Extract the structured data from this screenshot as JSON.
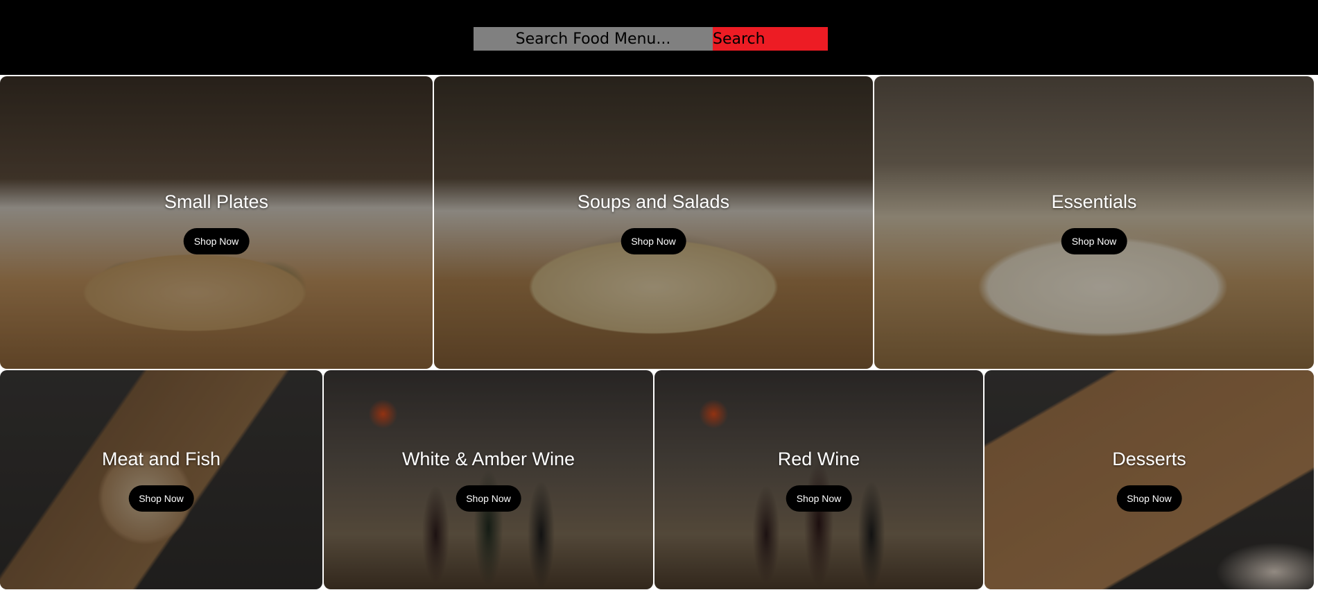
{
  "search": {
    "placeholder": "Search Food Menu...",
    "button_label": "Search"
  },
  "colors": {
    "header_bg": "#000000",
    "search_input_bg": "#808080",
    "search_button_bg": "#ed1c24",
    "shop_button_bg": "#000000"
  },
  "categories": [
    {
      "title": "Small Plates",
      "button_label": "Shop Now"
    },
    {
      "title": "Soups and Salads",
      "button_label": "Shop Now"
    },
    {
      "title": "Essentials",
      "button_label": "Shop Now"
    },
    {
      "title": "Meat and Fish",
      "button_label": "Shop Now"
    },
    {
      "title": "White & Amber Wine",
      "button_label": "Shop Now"
    },
    {
      "title": "Red Wine",
      "button_label": "Shop Now"
    },
    {
      "title": "Desserts",
      "button_label": "Shop Now"
    }
  ]
}
